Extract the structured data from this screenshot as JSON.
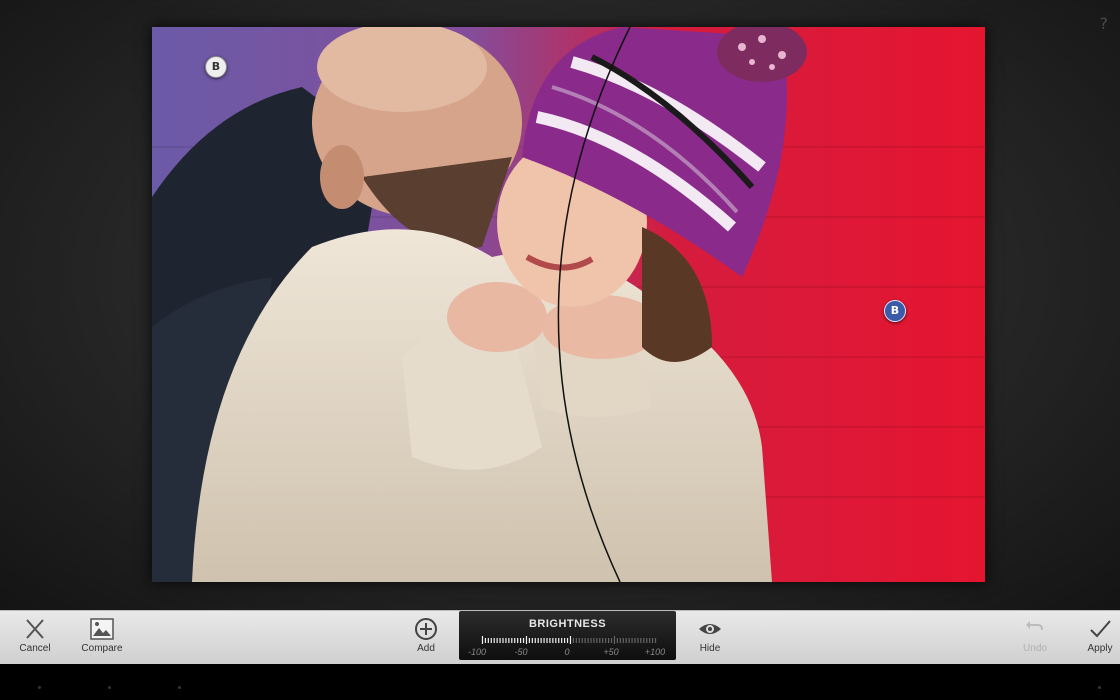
{
  "workspace": {
    "help_glyph": "?",
    "control_points": [
      {
        "label": "B",
        "state": "inactive"
      },
      {
        "label": "B",
        "state": "active"
      }
    ]
  },
  "toolbar": {
    "cancel_label": "Cancel",
    "compare_label": "Compare",
    "add_label": "Add",
    "hide_label": "Hide",
    "undo_label": "Undo",
    "apply_label": "Apply"
  },
  "slider": {
    "title": "BRIGHTNESS",
    "ticks": [
      "-100",
      "-50",
      "0",
      "+50",
      "+100"
    ],
    "value_fraction": 0.5
  },
  "icons": {
    "cancel": "close-icon",
    "compare": "image-icon",
    "add": "plus-circle-icon",
    "hide": "eye-icon",
    "undo": "undo-icon",
    "apply": "checkmark-icon"
  },
  "colors": {
    "toolbar_bg": "#dcdcdc",
    "slider_bg": "#1a1a1a",
    "active_point": "#3b5aa8"
  }
}
